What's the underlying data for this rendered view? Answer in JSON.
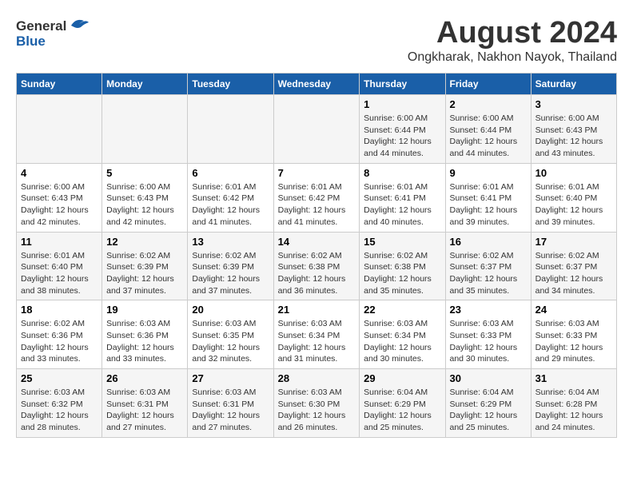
{
  "header": {
    "logo_general": "General",
    "logo_blue": "Blue",
    "title": "August 2024",
    "subtitle": "Ongkharak, Nakhon Nayok, Thailand"
  },
  "weekdays": [
    "Sunday",
    "Monday",
    "Tuesday",
    "Wednesday",
    "Thursday",
    "Friday",
    "Saturday"
  ],
  "weeks": [
    [
      {
        "day": "",
        "info": ""
      },
      {
        "day": "",
        "info": ""
      },
      {
        "day": "",
        "info": ""
      },
      {
        "day": "",
        "info": ""
      },
      {
        "day": "1",
        "info": "Sunrise: 6:00 AM\nSunset: 6:44 PM\nDaylight: 12 hours\nand 44 minutes."
      },
      {
        "day": "2",
        "info": "Sunrise: 6:00 AM\nSunset: 6:44 PM\nDaylight: 12 hours\nand 44 minutes."
      },
      {
        "day": "3",
        "info": "Sunrise: 6:00 AM\nSunset: 6:43 PM\nDaylight: 12 hours\nand 43 minutes."
      }
    ],
    [
      {
        "day": "4",
        "info": "Sunrise: 6:00 AM\nSunset: 6:43 PM\nDaylight: 12 hours\nand 42 minutes."
      },
      {
        "day": "5",
        "info": "Sunrise: 6:00 AM\nSunset: 6:43 PM\nDaylight: 12 hours\nand 42 minutes."
      },
      {
        "day": "6",
        "info": "Sunrise: 6:01 AM\nSunset: 6:42 PM\nDaylight: 12 hours\nand 41 minutes."
      },
      {
        "day": "7",
        "info": "Sunrise: 6:01 AM\nSunset: 6:42 PM\nDaylight: 12 hours\nand 41 minutes."
      },
      {
        "day": "8",
        "info": "Sunrise: 6:01 AM\nSunset: 6:41 PM\nDaylight: 12 hours\nand 40 minutes."
      },
      {
        "day": "9",
        "info": "Sunrise: 6:01 AM\nSunset: 6:41 PM\nDaylight: 12 hours\nand 39 minutes."
      },
      {
        "day": "10",
        "info": "Sunrise: 6:01 AM\nSunset: 6:40 PM\nDaylight: 12 hours\nand 39 minutes."
      }
    ],
    [
      {
        "day": "11",
        "info": "Sunrise: 6:01 AM\nSunset: 6:40 PM\nDaylight: 12 hours\nand 38 minutes."
      },
      {
        "day": "12",
        "info": "Sunrise: 6:02 AM\nSunset: 6:39 PM\nDaylight: 12 hours\nand 37 minutes."
      },
      {
        "day": "13",
        "info": "Sunrise: 6:02 AM\nSunset: 6:39 PM\nDaylight: 12 hours\nand 37 minutes."
      },
      {
        "day": "14",
        "info": "Sunrise: 6:02 AM\nSunset: 6:38 PM\nDaylight: 12 hours\nand 36 minutes."
      },
      {
        "day": "15",
        "info": "Sunrise: 6:02 AM\nSunset: 6:38 PM\nDaylight: 12 hours\nand 35 minutes."
      },
      {
        "day": "16",
        "info": "Sunrise: 6:02 AM\nSunset: 6:37 PM\nDaylight: 12 hours\nand 35 minutes."
      },
      {
        "day": "17",
        "info": "Sunrise: 6:02 AM\nSunset: 6:37 PM\nDaylight: 12 hours\nand 34 minutes."
      }
    ],
    [
      {
        "day": "18",
        "info": "Sunrise: 6:02 AM\nSunset: 6:36 PM\nDaylight: 12 hours\nand 33 minutes."
      },
      {
        "day": "19",
        "info": "Sunrise: 6:03 AM\nSunset: 6:36 PM\nDaylight: 12 hours\nand 33 minutes."
      },
      {
        "day": "20",
        "info": "Sunrise: 6:03 AM\nSunset: 6:35 PM\nDaylight: 12 hours\nand 32 minutes."
      },
      {
        "day": "21",
        "info": "Sunrise: 6:03 AM\nSunset: 6:34 PM\nDaylight: 12 hours\nand 31 minutes."
      },
      {
        "day": "22",
        "info": "Sunrise: 6:03 AM\nSunset: 6:34 PM\nDaylight: 12 hours\nand 30 minutes."
      },
      {
        "day": "23",
        "info": "Sunrise: 6:03 AM\nSunset: 6:33 PM\nDaylight: 12 hours\nand 30 minutes."
      },
      {
        "day": "24",
        "info": "Sunrise: 6:03 AM\nSunset: 6:33 PM\nDaylight: 12 hours\nand 29 minutes."
      }
    ],
    [
      {
        "day": "25",
        "info": "Sunrise: 6:03 AM\nSunset: 6:32 PM\nDaylight: 12 hours\nand 28 minutes."
      },
      {
        "day": "26",
        "info": "Sunrise: 6:03 AM\nSunset: 6:31 PM\nDaylight: 12 hours\nand 27 minutes."
      },
      {
        "day": "27",
        "info": "Sunrise: 6:03 AM\nSunset: 6:31 PM\nDaylight: 12 hours\nand 27 minutes."
      },
      {
        "day": "28",
        "info": "Sunrise: 6:03 AM\nSunset: 6:30 PM\nDaylight: 12 hours\nand 26 minutes."
      },
      {
        "day": "29",
        "info": "Sunrise: 6:04 AM\nSunset: 6:29 PM\nDaylight: 12 hours\nand 25 minutes."
      },
      {
        "day": "30",
        "info": "Sunrise: 6:04 AM\nSunset: 6:29 PM\nDaylight: 12 hours\nand 25 minutes."
      },
      {
        "day": "31",
        "info": "Sunrise: 6:04 AM\nSunset: 6:28 PM\nDaylight: 12 hours\nand 24 minutes."
      }
    ]
  ]
}
